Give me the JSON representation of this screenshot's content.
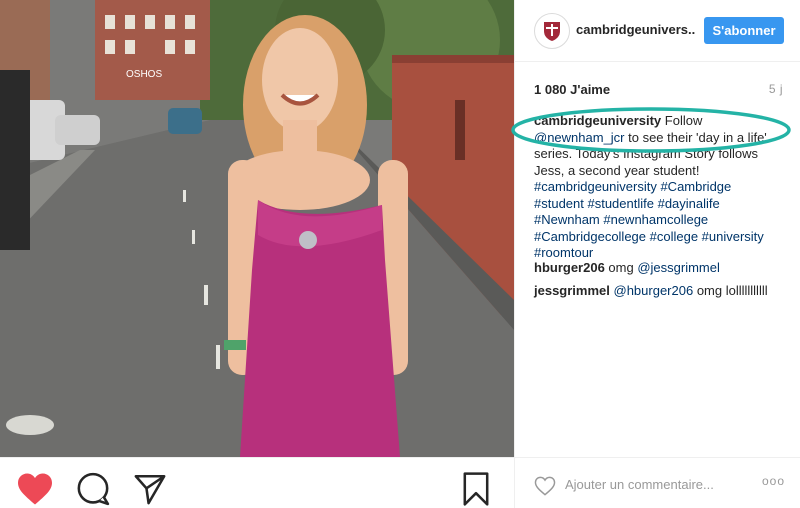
{
  "post": {
    "photo_caption_text": "OSHOS",
    "username": "cambridgeunivers...",
    "follow_label": "S'abonner",
    "likes": "1 080 J'aime",
    "time_ago": "5 j",
    "caption": {
      "user": "cambridgeuniversity",
      "text1": " Follow ",
      "mention": "@newnham_jcr",
      "text2": " to see their 'day in a life' series. Today's Instagram Story follows Jess, a second year student! ",
      "tags": "#cambridgeuniversity #Cambridge #student #studentlife #dayinalife #Newnham #newnhamcollege #Cambridgecollege #college #university #roomtour"
    },
    "comments": [
      {
        "user": "hburger206",
        "text": " omg ",
        "mention": "@jessgrimmel",
        "rest": ""
      },
      {
        "user": "jessgrimmel",
        "text": " ",
        "mention": "@hburger206",
        "rest": " omg lolllllllllll"
      }
    ],
    "comment_placeholder": "Ajouter un commentaire...",
    "more_label": "ooo"
  },
  "colors": {
    "accent": "#3897f0",
    "like_heart": "#ed4956",
    "annotation": "#24b3a6",
    "hashtag": "#003569"
  },
  "icons": {
    "like": "heart-filled-icon",
    "comment": "comment-bubble-icon",
    "share": "paper-plane-icon",
    "save": "bookmark-icon",
    "comment_like": "heart-outline-icon",
    "more": "more-dots-icon"
  }
}
